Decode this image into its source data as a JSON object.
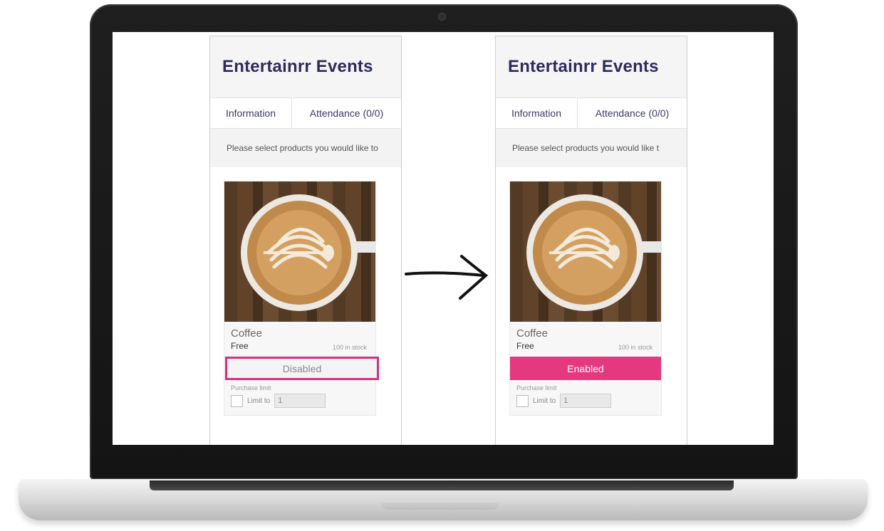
{
  "panels": [
    {
      "title": "Entertainrr Events",
      "tabs": [
        "Information",
        "Attendance (0/0)"
      ],
      "notice": "Please select products you would like to",
      "product": {
        "name": "Coffee",
        "price": "Free",
        "stock": "100 in stock",
        "button_label": "Disabled",
        "purchase_limit_label": "Purchase limit",
        "limit_to_label": "Limit to",
        "limit_value": "1"
      }
    },
    {
      "title": "Entertainrr Events",
      "tabs": [
        "Information",
        "Attendance (0/0)"
      ],
      "notice": "Please select products you would like t",
      "product": {
        "name": "Coffee",
        "price": "Free",
        "stock": "100 in stock",
        "button_label": "Enabled",
        "purchase_limit_label": "Purchase limit",
        "limit_to_label": "Limit to",
        "limit_value": "1"
      }
    }
  ],
  "colors": {
    "title": "#2b2d5c",
    "enabled_button": "#e5397f",
    "highlight_border": "#d6307d"
  },
  "icons": [
    "arrow-right-icon",
    "camera-icon"
  ]
}
